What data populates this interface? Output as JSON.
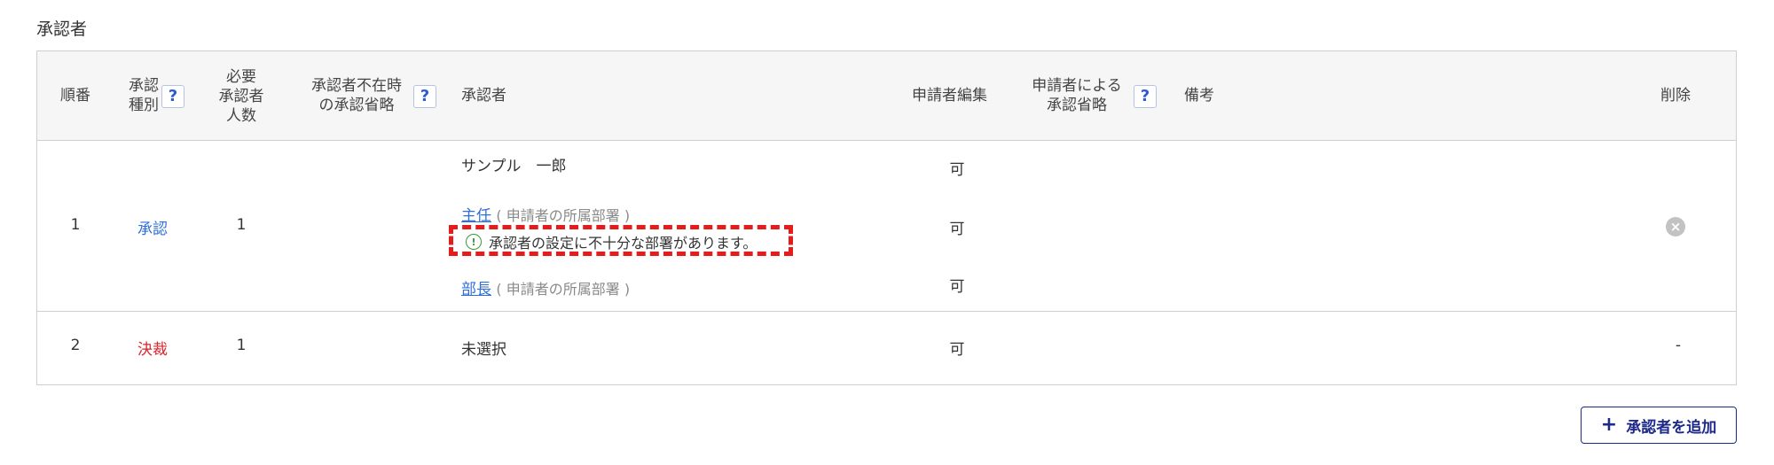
{
  "section_title": "承認者",
  "headers": {
    "order": "順番",
    "approval_type_line1": "承認",
    "approval_type_line2": "種別",
    "required_count_line1": "必要",
    "required_count_line2": "承認者",
    "required_count_line3": "人数",
    "absent_skip_line1": "承認者不在時",
    "absent_skip_line2": "の承認省略",
    "approver": "承認者",
    "applicant_edit": "申請者編集",
    "applicant_skip_line1": "申請者による",
    "applicant_skip_line2": "承認省略",
    "remarks": "備考",
    "delete": "削除",
    "help_mark": "?"
  },
  "rows": [
    {
      "order": "1",
      "type": "承認",
      "required": "1",
      "approvers": [
        {
          "name": "サンプル　一郎",
          "edit": "可"
        },
        {
          "name": "主任",
          "paren": "( 申請者の所属部署 )",
          "edit": "可"
        },
        {
          "name": "部長",
          "paren": "( 申請者の所属部署 )",
          "edit": "可"
        }
      ],
      "warning": "承認者の設定に不十分な部署があります。",
      "delete_icon": "close-circle-icon"
    },
    {
      "order": "2",
      "type": "決裁",
      "required": "1",
      "approver": "未選択",
      "edit": "可",
      "delete": "-"
    }
  ],
  "add_button": {
    "plus": "+",
    "label": "承認者を追加"
  },
  "colors": {
    "accent_blue": "#2f6fd8",
    "final_red": "#d9242c",
    "warn_border": "#e51c1c",
    "button_navy": "#1d2a8a"
  }
}
